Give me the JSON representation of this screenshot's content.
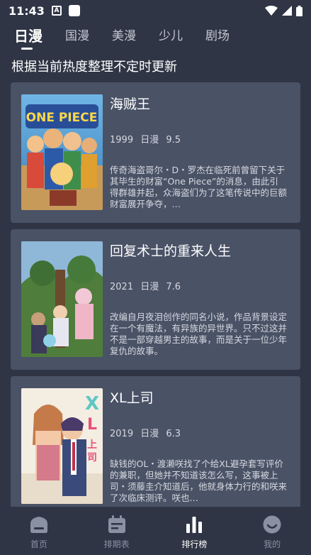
{
  "status_bar": {
    "time": "11:43",
    "notif_letter": "A"
  },
  "tabs": [
    {
      "label": "日漫",
      "active": true
    },
    {
      "label": "国漫",
      "active": false
    },
    {
      "label": "美漫",
      "active": false
    },
    {
      "label": "少儿",
      "active": false
    },
    {
      "label": "剧场",
      "active": false
    }
  ],
  "subtitle": "根据当前热度整理不定时更新",
  "cards": [
    {
      "title": "海贼王",
      "year": "1999",
      "region": "日漫",
      "score": "9.5",
      "description": "传奇海盗哥尔・D・罗杰在临死前曾留下关于其毕生的财富“One Piece”的消息，由此引得群雄并起，众海盗们为了这笔传说中的巨额财富展开争夺，…",
      "poster_logo": "ONE PIECE"
    },
    {
      "title": "回复术士的重来人生",
      "year": "2021",
      "region": "日漫",
      "score": "7.6",
      "description": "改编自月夜泪创作的同名小说，作品背景设定在一个有魔法，有异族的异世界。只不过这并不是一部穿越男主的故事，而是关于一位少年复仇的故事。"
    },
    {
      "title": "XL上司",
      "year": "2019",
      "region": "日漫",
      "score": "6.3",
      "description": "缺钱的OL・渡濑咲找了个给XL避孕套写评价的兼职，但她并不知道该怎么写，这事被上司・须藤圭介知道后，他就身体力行的和咲来了次临床测评。咲也…",
      "poster_logo": "XL上司"
    }
  ],
  "bottom_nav": [
    {
      "label": "首页",
      "icon": "home-icon",
      "active": false
    },
    {
      "label": "排期表",
      "icon": "calendar-icon",
      "active": false
    },
    {
      "label": "排行榜",
      "icon": "ranking-icon",
      "active": true
    },
    {
      "label": "我的",
      "icon": "profile-icon",
      "active": false
    }
  ],
  "colors": {
    "background": "#2f3545",
    "card": "#4a5266",
    "inactive": "#8a91a3"
  }
}
